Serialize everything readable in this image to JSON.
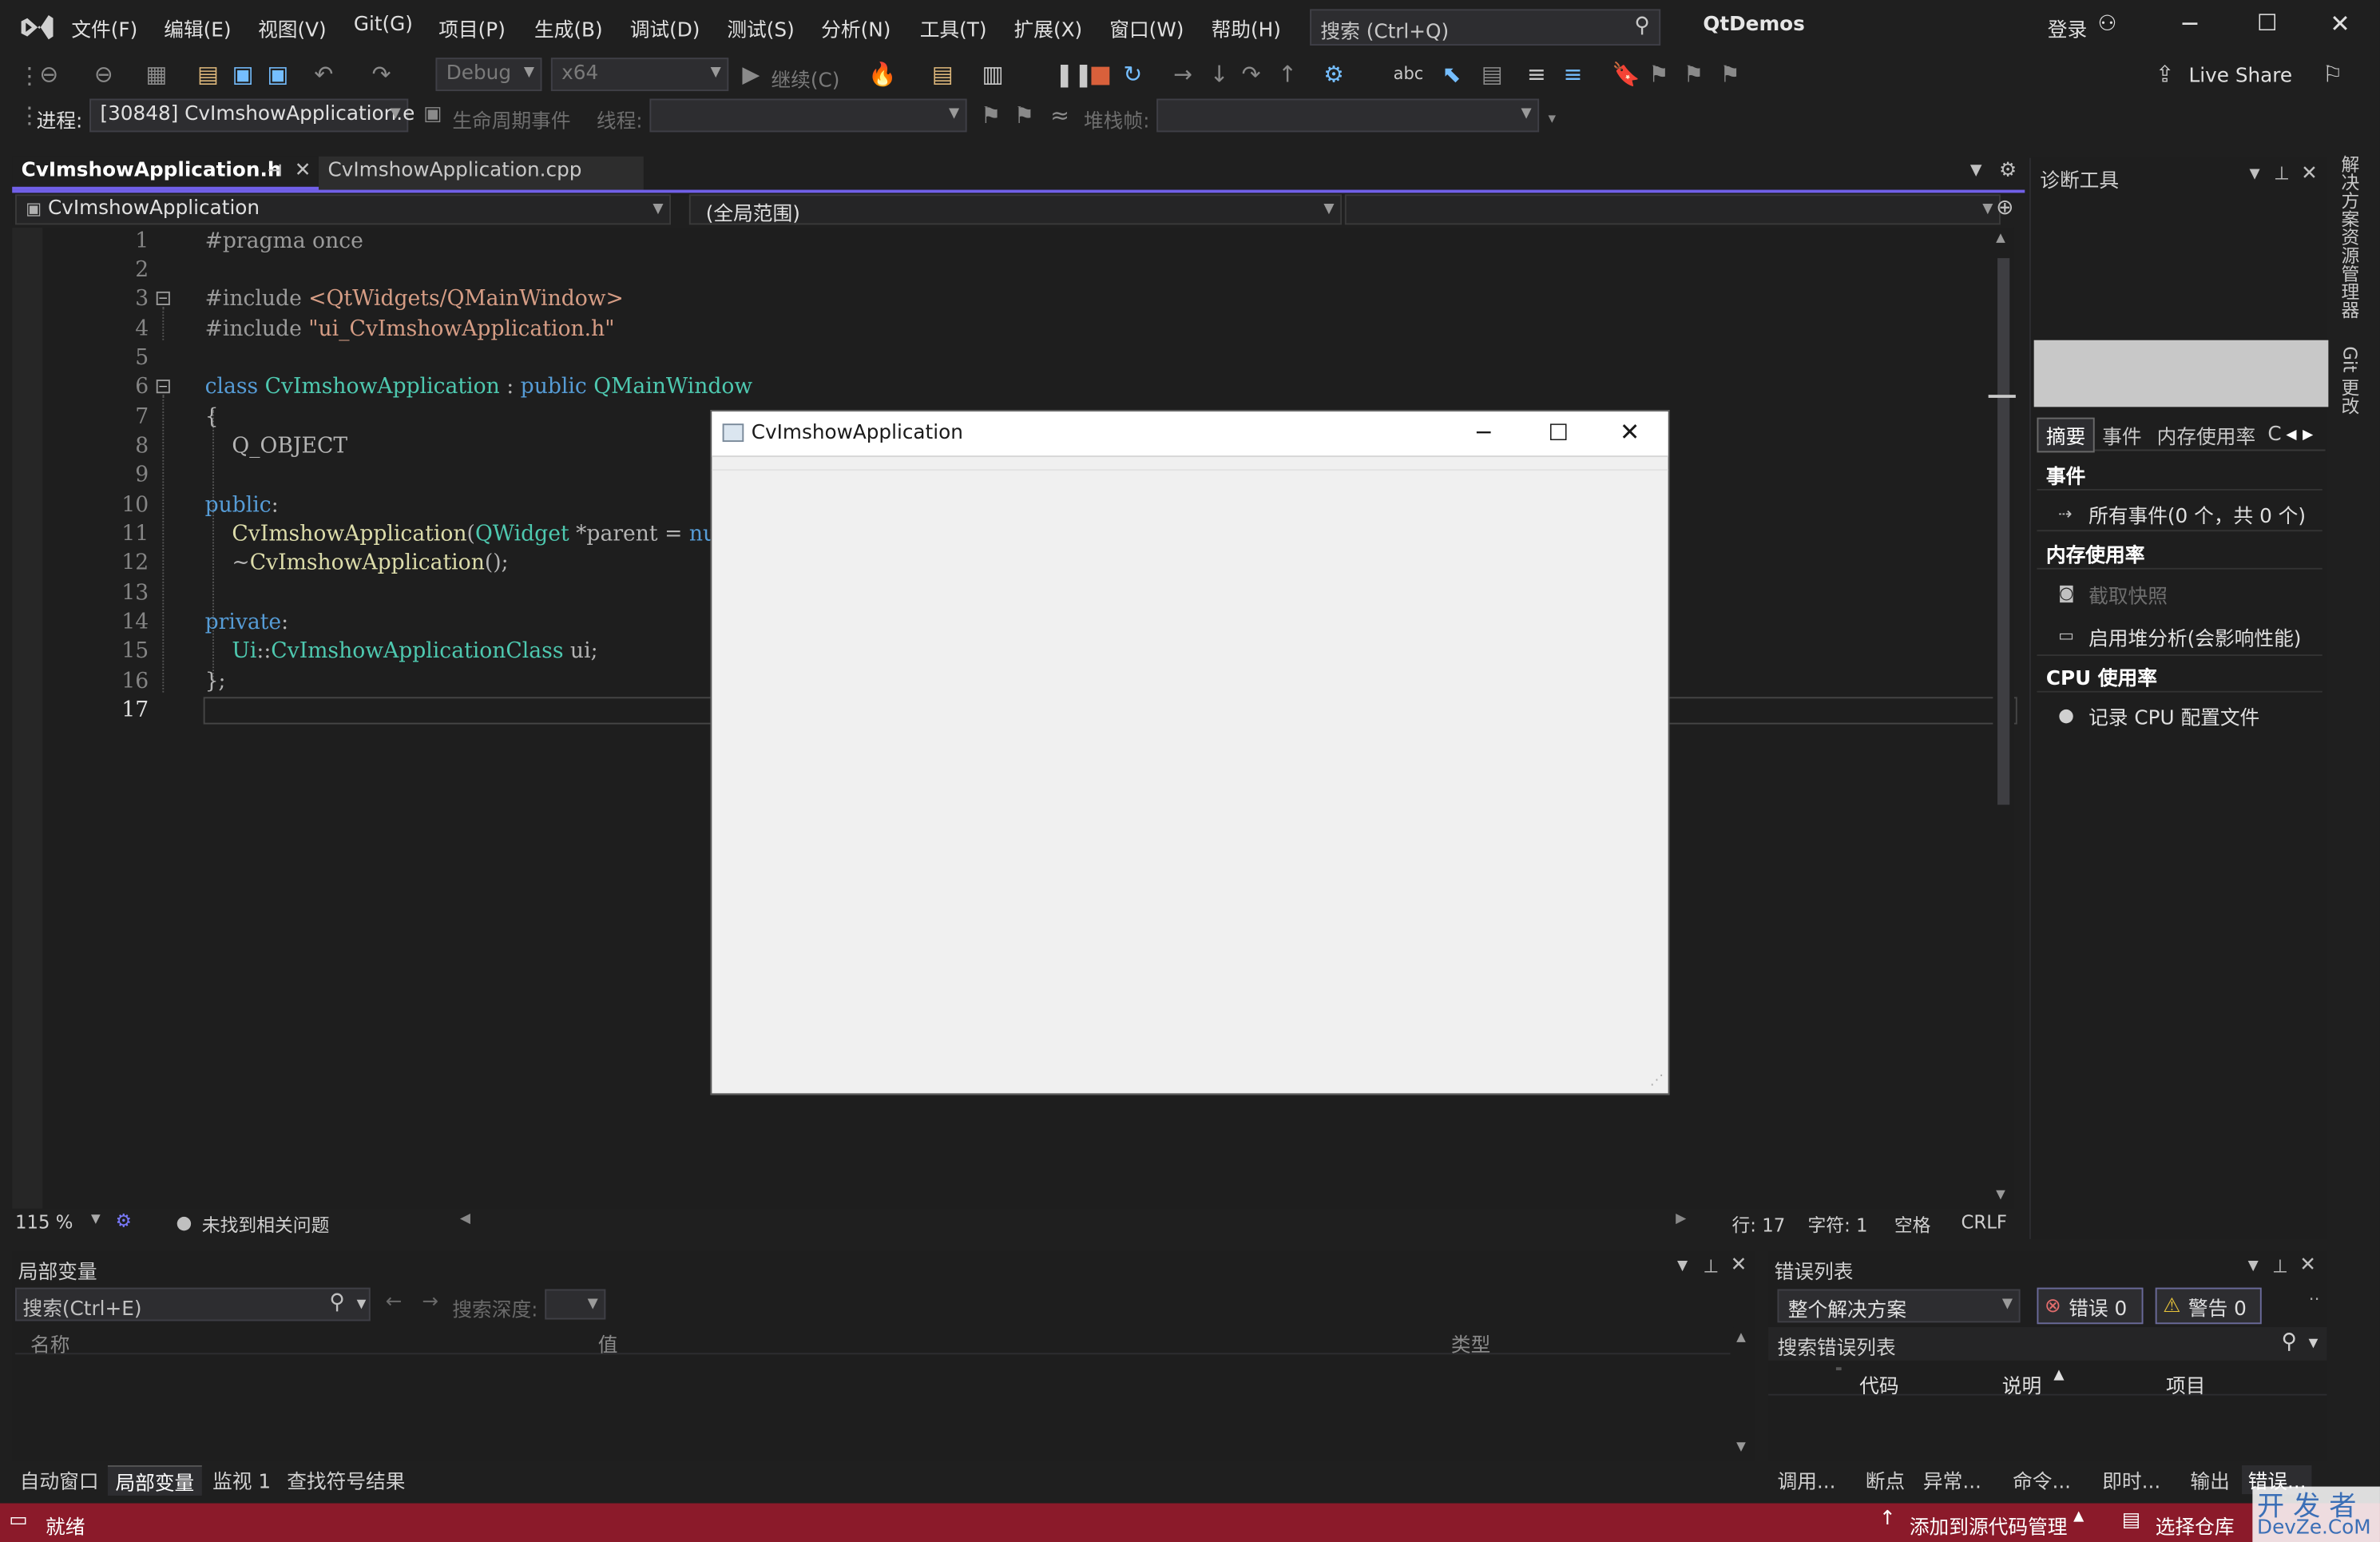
{
  "menu": {
    "items": [
      "文件(F)",
      "编辑(E)",
      "视图(V)",
      "Git(G)",
      "项目(P)",
      "生成(B)",
      "调试(D)",
      "测试(S)",
      "分析(N)",
      "工具(T)",
      "扩展(X)",
      "窗口(W)",
      "帮助(H)"
    ],
    "search_placeholder": "搜索 (Ctrl+Q)",
    "solution_name": "QtDemos",
    "login": "登录"
  },
  "toolbar": {
    "config": "Debug",
    "platform": "x64",
    "continue_label": "继续(C)",
    "live_share": "Live Share",
    "process_label": "进程:",
    "process_value": "[30848] CvImshowApplication.e",
    "lifecycle_label": "生命周期事件",
    "thread_label": "线程:",
    "stackframe_label": "堆栈帧:"
  },
  "editor": {
    "tabs": [
      "CvImshowApplication.h",
      "CvImshowApplication.cpp"
    ],
    "scope_class": "CvImshowApplication",
    "scope_global": "(全局范围)",
    "line_numbers": [
      "1",
      "2",
      "3",
      "4",
      "5",
      "6",
      "7",
      "8",
      "9",
      "10",
      "11",
      "12",
      "13",
      "14",
      "15",
      "16",
      "17"
    ],
    "zoom": "115 %",
    "issues": "未找到相关问题",
    "row": "行: 17",
    "col": "字符: 1",
    "spaces": "空格",
    "eol": "CRLF"
  },
  "diagnostics": {
    "title": "诊断工具",
    "tabs": [
      "摘要",
      "事件",
      "内存使用率",
      "C"
    ],
    "events_heading": "事件",
    "all_events": "所有事件(0 个，共 0 个)",
    "memory_heading": "内存使用率",
    "snapshot": "截取快照",
    "heap_analysis": "启用堆分析(会影响性能)",
    "cpu_heading": "CPU 使用率",
    "cpu_profile": "记录 CPU 配置文件",
    "side_labels": [
      "解决方案资源管理器",
      "Git 更改"
    ]
  },
  "locals": {
    "title": "局部变量",
    "search_placeholder": "搜索(Ctrl+E)",
    "search_depth": "搜索深度:",
    "columns": [
      "名称",
      "值",
      "类型"
    ]
  },
  "bottom_tabs_left": [
    "自动窗口",
    "局部变量",
    "监视 1",
    "查找符号结果"
  ],
  "errors": {
    "title": "错误列表",
    "scope": "整个解决方案",
    "error_count": "错误 0",
    "warning_count": "警告 0",
    "search_placeholder": "搜索错误列表",
    "columns": [
      "代码",
      "说明",
      "项目"
    ]
  },
  "bottom_tabs_right": [
    "调用...",
    "断点",
    "异常...",
    "命令...",
    "即时...",
    "输出",
    "错误..."
  ],
  "statusbar": {
    "ready": "就绪",
    "add_source": "添加到源代码管理",
    "select_repo": "选择仓库",
    "watermark_top": "开 发 者",
    "watermark_bottom": "DevZe.CoM"
  },
  "qt_window": {
    "title": "CvImshowApplication"
  },
  "colors": {
    "accent": "#8b1a2a",
    "tab_active_border": "#7160e8",
    "keyword": "#569cd6",
    "type": "#4ec9b0",
    "string": "#d69d85"
  }
}
